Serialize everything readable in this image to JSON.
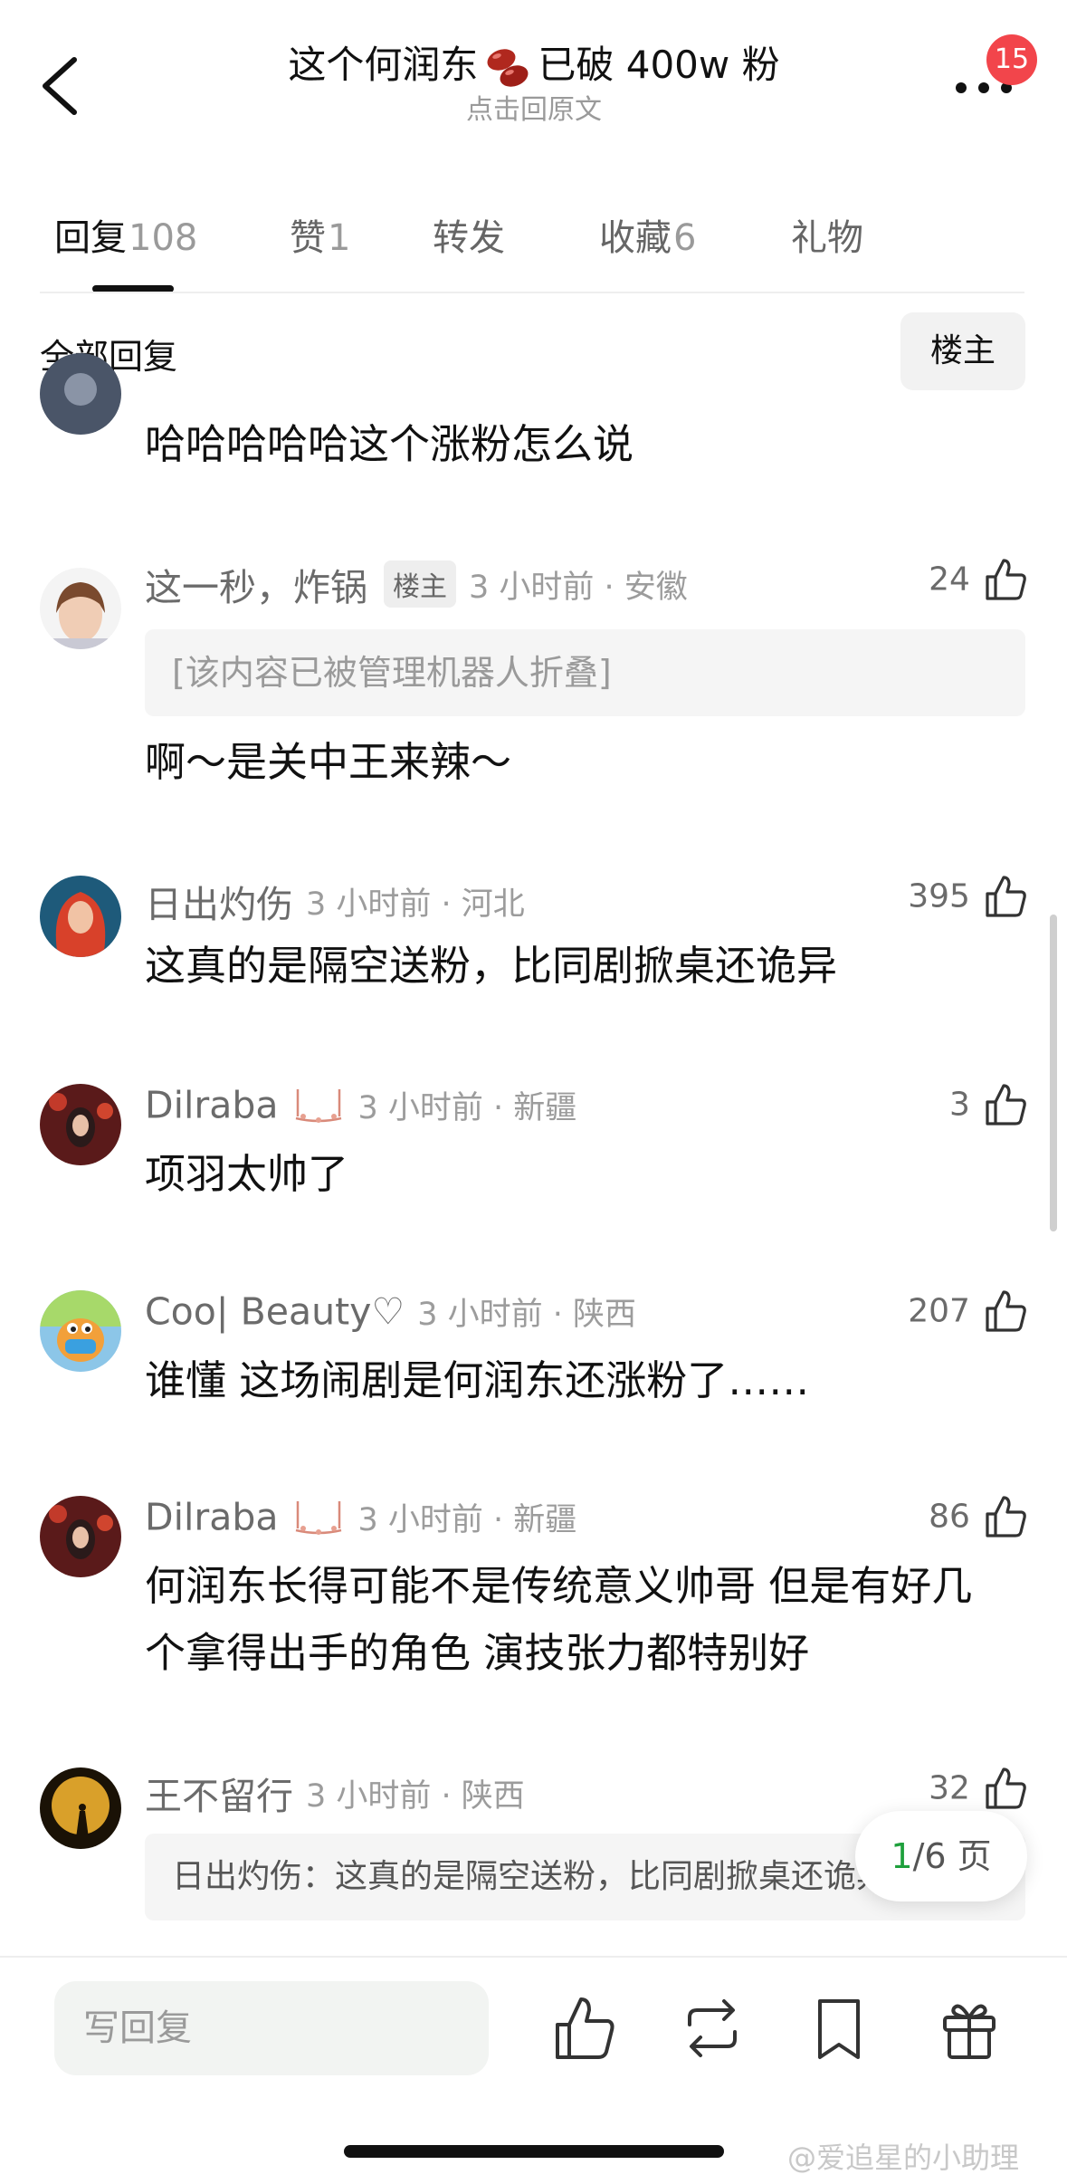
{
  "header": {
    "title_prefix": "这个何润东",
    "title_suffix": "已破 400w 粉",
    "subtitle": "点击回原文",
    "badge_count": "15",
    "icons": {
      "back": "chevron-left-icon",
      "bean": "red-bean-emoji-icon",
      "more": "more-dots-icon"
    }
  },
  "tabs": [
    {
      "label": "回复",
      "count": "108",
      "active": true
    },
    {
      "label": "赞",
      "count": "1",
      "active": false
    },
    {
      "label": "转发",
      "count": "",
      "active": false
    },
    {
      "label": "收藏",
      "count": "6",
      "active": false
    },
    {
      "label": "礼物",
      "count": "",
      "active": false
    }
  ],
  "filter": {
    "all_label": "全部回复",
    "op_label": "楼主"
  },
  "comments": [
    {
      "name": "",
      "time": "",
      "text": "哈哈哈哈哈这个涨粉怎么说",
      "likes": ""
    },
    {
      "name": "这一秒，炸锅",
      "op_tag": "楼主",
      "time": "3 小时前 · 安徽",
      "likes": "24",
      "folded": "[该内容已被管理机器人折叠]",
      "text": "啊～是关中王来辣～"
    },
    {
      "name": "日出灼伤",
      "time": "3 小时前 · 河北",
      "likes": "395",
      "text": "这真的是隔空送粉，比同剧掀桌还诡异"
    },
    {
      "name": "Dilraba",
      "time": "3 小时前 · 新疆",
      "likes": "3",
      "text": "项羽太帅了"
    },
    {
      "name": "Coo| Beauty♡",
      "time": "3 小时前 · 陕西",
      "likes": "207",
      "text": "谁懂 这场闹剧是何润东还涨粉了……"
    },
    {
      "name": "Dilraba",
      "time": "3 小时前 · 新疆",
      "likes": "86",
      "text_line1": "何润东长得可能不是传统意义帅哥 但是有好几",
      "text_line2": "个拿得出手的角色 演技张力都特别好"
    },
    {
      "name": "王不留行",
      "time": "3 小时前 · 陕西",
      "likes": "32",
      "quote": "日出灼伤：这真的是隔空送粉，比同剧掀桌还诡异"
    }
  ],
  "pagination": {
    "current": "1",
    "total": "/6 页"
  },
  "bottom_bar": {
    "placeholder": "写回复",
    "icons": [
      "thumbs-up-icon",
      "repost-icon",
      "bookmark-icon",
      "gift-icon"
    ]
  },
  "watermark": "@爱追星的小助理",
  "colors": {
    "badge": "#f2454b",
    "page_current": "#1ea03c"
  }
}
